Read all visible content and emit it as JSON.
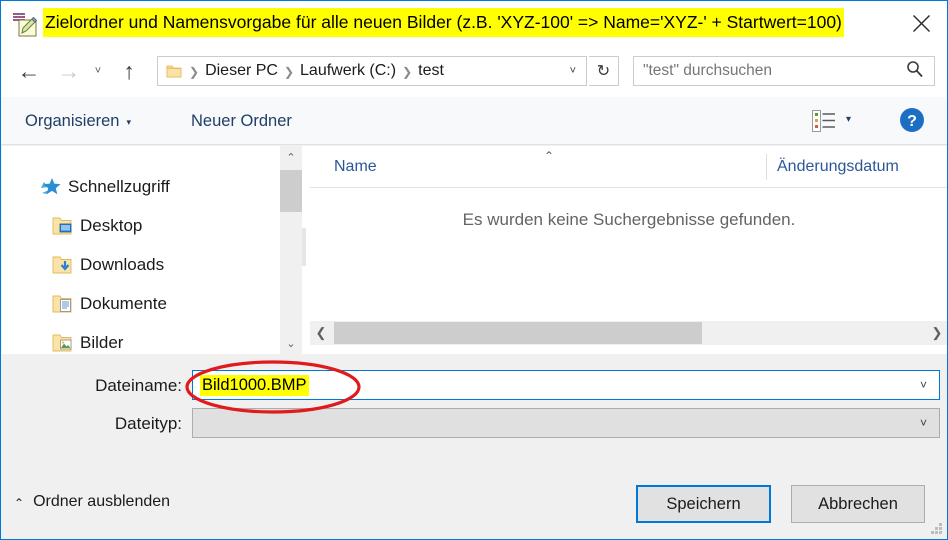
{
  "window": {
    "title": "Zielordner und Namensvorgabe für alle neuen Bilder (z.B. 'XYZ-100' => Name='XYZ-' + Startwert=100)",
    "title_highlight_color": "#ffff00",
    "app_icon": "paint-image-icon",
    "close_label": "✕",
    "accent_color": "#0078d7"
  },
  "navbar": {
    "back_label": "←",
    "forward_label": "→",
    "recent_label": "˅",
    "up_label": "↑",
    "folder_icon": "folder-icon",
    "breadcrumb": [
      {
        "label": "Dieser PC"
      },
      {
        "label": "Laufwerk (C:)"
      },
      {
        "label": "test"
      }
    ],
    "breadcrumb_separator": "❯",
    "breadcrumb_dropdown": "˅",
    "refresh_label": "↻",
    "search": {
      "placeholder": "\"test\" durchsuchen",
      "value": "",
      "icon": "search-icon"
    }
  },
  "toolbar": {
    "organize_label": "Organisieren",
    "organize_caret": "▾",
    "new_folder_label": "Neuer Ordner",
    "view_icon": "view-list-icon",
    "view_caret": "▾",
    "help_icon": "help-icon",
    "help_label": "?"
  },
  "navpane": {
    "items": [
      {
        "label": "Schnellzugriff",
        "icon": "quick-access-star-icon",
        "pinned": false
      },
      {
        "label": "Desktop",
        "icon": "folder-desktop-icon",
        "pinned": true
      },
      {
        "label": "Downloads",
        "icon": "folder-downloads-icon",
        "pinned": true
      },
      {
        "label": "Dokumente",
        "icon": "folder-documents-icon",
        "pinned": true
      },
      {
        "label": "Bilder",
        "icon": "folder-pictures-icon",
        "pinned": true
      }
    ],
    "scroll_up": "⌃",
    "scroll_down": "⌄"
  },
  "filepane": {
    "columns": [
      {
        "label": "Name",
        "sorted": true,
        "sort_caret": "⌃"
      },
      {
        "label": "Änderungsdatum",
        "sorted": false
      }
    ],
    "rows": [],
    "empty_message": "Es wurden keine Suchergebnisse gefunden.",
    "hscroll_left": "❮",
    "hscroll_right": "❯"
  },
  "form": {
    "filename_label": "Dateiname:",
    "filename_value": "Bild1000.BMP",
    "filename_highlight_color": "#ffff00",
    "filetype_label": "Dateityp:",
    "filetype_value": "",
    "combo_caret": "˅",
    "annotation": {
      "shape": "ellipse",
      "color": "#e01b1b"
    }
  },
  "footer": {
    "hide_folders_caret": "⌃",
    "hide_folders_label": "Ordner ausblenden",
    "save_label": "Speichern",
    "cancel_label": "Abbrechen",
    "resize_grip": "resize-grip-icon"
  }
}
